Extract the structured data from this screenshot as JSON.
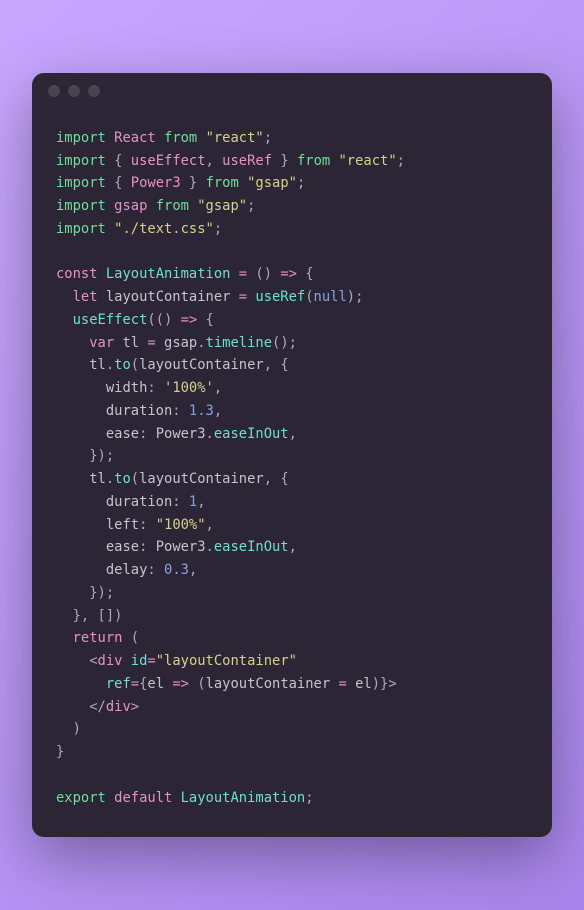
{
  "code": {
    "l1": {
      "kw": "import",
      "name": "React",
      "from": "from",
      "str": "\"react\""
    },
    "l2": {
      "kw": "import",
      "brace_open": "{ ",
      "n1": "useEffect",
      "comma": ", ",
      "n2": "useRef",
      "brace_close": " }",
      "from": "from",
      "str": "\"react\""
    },
    "l3": {
      "kw": "import",
      "brace_open": "{ ",
      "n1": "Power3",
      "brace_close": " }",
      "from": "from",
      "str": "\"gsap\""
    },
    "l4": {
      "kw": "import",
      "name": "gsap",
      "from": "from",
      "str": "\"gsap\""
    },
    "l5": {
      "kw": "import",
      "str": "\"./text.css\""
    },
    "l7": {
      "const": "const",
      "name": "LayoutAnimation",
      "eq": " = ",
      "paren": "()",
      "arrow": " => ",
      "brace": "{"
    },
    "l8": {
      "let": "let",
      "name": "layoutContainer",
      "eq": " = ",
      "fn": "useRef",
      "open": "(",
      "null": "null",
      "close": ");"
    },
    "l9": {
      "fn": "useEffect",
      "open": "(()",
      "arrow": " => ",
      "brace": "{"
    },
    "l10": {
      "var": "var",
      "name": "tl",
      "eq": " = ",
      "obj": "gsap",
      "dot": ".",
      "fn": "timeline",
      "call": "();"
    },
    "l11": {
      "obj": "tl",
      "dot": ".",
      "fn": "to",
      "open": "(",
      "arg": "layoutContainer",
      "comma": ", {"
    },
    "l12": {
      "prop": "width",
      "colon": ": ",
      "val": "'100%'",
      "comma": ","
    },
    "l13": {
      "prop": "duration",
      "colon": ": ",
      "val": "1.3",
      "comma": ","
    },
    "l14": {
      "prop": "ease",
      "colon": ": ",
      "obj": "Power3",
      "dot": ".",
      "val": "easeInOut",
      "comma": ","
    },
    "l15": {
      "close": "});"
    },
    "l16": {
      "obj": "tl",
      "dot": ".",
      "fn": "to",
      "open": "(",
      "arg": "layoutContainer",
      "comma": ", {"
    },
    "l17": {
      "prop": "duration",
      "colon": ": ",
      "val": "1",
      "comma": ","
    },
    "l18": {
      "prop": "left",
      "colon": ": ",
      "val": "\"100%\"",
      "comma": ","
    },
    "l19": {
      "prop": "ease",
      "colon": ": ",
      "obj": "Power3",
      "dot": ".",
      "val": "easeInOut",
      "comma": ","
    },
    "l20": {
      "prop": "delay",
      "colon": ": ",
      "val": "0.3",
      "comma": ","
    },
    "l21": {
      "close": "});"
    },
    "l22": {
      "close": "}, [])"
    },
    "l23": {
      "return": "return",
      "paren": " ("
    },
    "l24": {
      "open": "<",
      "tag": "div",
      "attr": "id",
      "eq": "=",
      "val": "\"layoutContainer\""
    },
    "l25": {
      "attr": "ref",
      "eq": "=",
      "bopen": "{",
      "arg": "el",
      "arrow": " => ",
      "popen": "(",
      "lhs": "layoutContainer",
      "aeq": " = ",
      "rhs": "el",
      "pclose": ")",
      "bclose": "}",
      "tclose": ">"
    },
    "l26": {
      "open": "</",
      "tag": "div",
      "close": ">"
    },
    "l27": {
      "paren": ")"
    },
    "l28": {
      "brace": "}"
    },
    "l30": {
      "export": "export",
      "default": "default",
      "name": "LayoutAnimation"
    }
  }
}
